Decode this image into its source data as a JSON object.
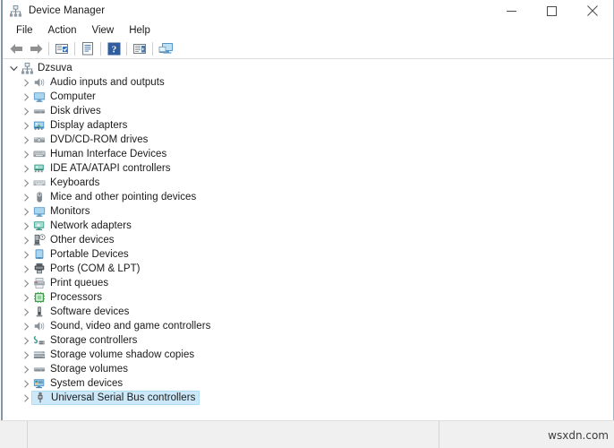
{
  "window": {
    "title": "Device Manager",
    "title_icon": "device-manager-icon",
    "controls": {
      "minimize": "minimize-icon",
      "maximize": "maximize-icon",
      "close": "close-icon"
    }
  },
  "menubar": {
    "items": [
      {
        "label": "File"
      },
      {
        "label": "Action"
      },
      {
        "label": "View"
      },
      {
        "label": "Help"
      }
    ]
  },
  "toolbar": {
    "buttons": [
      {
        "name": "back-button",
        "icon": "back-arrow-icon"
      },
      {
        "name": "forward-button",
        "icon": "forward-arrow-icon"
      },
      {
        "name": "separator-1",
        "icon": "separator"
      },
      {
        "name": "show-hidden-devices-button",
        "icon": "monitor-list-icon"
      },
      {
        "name": "separator-2",
        "icon": "separator"
      },
      {
        "name": "properties-button",
        "icon": "properties-page-icon"
      },
      {
        "name": "separator-3",
        "icon": "separator"
      },
      {
        "name": "help-button",
        "icon": "question-mark-icon"
      },
      {
        "name": "separator-4",
        "icon": "separator"
      },
      {
        "name": "scan-for-hardware-changes-button",
        "icon": "scan-hardware-icon"
      },
      {
        "name": "separator-5",
        "icon": "separator"
      },
      {
        "name": "update-driver-button",
        "icon": "computer-update-icon"
      }
    ]
  },
  "tree": {
    "root": {
      "label": "Dzsuva",
      "icon": "computer-root-icon",
      "expanded": true,
      "chevron": "chevron-down-icon"
    },
    "nodes": [
      {
        "label": "Audio inputs and outputs",
        "icon": "speaker-icon",
        "selected": false
      },
      {
        "label": "Computer",
        "icon": "monitor-icon",
        "selected": false
      },
      {
        "label": "Disk drives",
        "icon": "disk-drive-icon",
        "selected": false
      },
      {
        "label": "Display adapters",
        "icon": "display-adapter-icon",
        "selected": false
      },
      {
        "label": "DVD/CD-ROM drives",
        "icon": "optical-drive-icon",
        "selected": false
      },
      {
        "label": "Human Interface Devices",
        "icon": "hid-keyboard-icon",
        "selected": false
      },
      {
        "label": "IDE ATA/ATAPI controllers",
        "icon": "ide-controller-icon",
        "selected": false
      },
      {
        "label": "Keyboards",
        "icon": "keyboard-icon",
        "selected": false
      },
      {
        "label": "Mice and other pointing devices",
        "icon": "mouse-icon",
        "selected": false
      },
      {
        "label": "Monitors",
        "icon": "monitor-icon",
        "selected": false
      },
      {
        "label": "Network adapters",
        "icon": "network-adapter-icon",
        "selected": false
      },
      {
        "label": "Other devices",
        "icon": "unknown-device-icon",
        "selected": false
      },
      {
        "label": "Portable Devices",
        "icon": "portable-device-icon",
        "selected": false
      },
      {
        "label": "Ports (COM & LPT)",
        "icon": "port-icon",
        "selected": false
      },
      {
        "label": "Print queues",
        "icon": "printer-icon",
        "selected": false
      },
      {
        "label": "Processors",
        "icon": "processor-icon",
        "selected": false
      },
      {
        "label": "Software devices",
        "icon": "software-device-icon",
        "selected": false
      },
      {
        "label": "Sound, video and game controllers",
        "icon": "speaker-icon",
        "selected": false
      },
      {
        "label": "Storage controllers",
        "icon": "storage-controller-icon",
        "selected": false
      },
      {
        "label": "Storage volume shadow copies",
        "icon": "shadow-copy-icon",
        "selected": false
      },
      {
        "label": "Storage volumes",
        "icon": "storage-volume-icon",
        "selected": false
      },
      {
        "label": "System devices",
        "icon": "system-device-icon",
        "selected": false
      },
      {
        "label": "Universal Serial Bus controllers",
        "icon": "usb-icon",
        "selected": true
      }
    ],
    "child_chevron": "chevron-right-icon"
  },
  "statusbar": {
    "left_text": "",
    "right_text": ""
  },
  "watermark": {
    "text": "wsxdn.com"
  },
  "colors": {
    "selection_fill": "#cce8f9",
    "selection_border": "#addcf3",
    "window_border": "#9bb7c9",
    "statusbar_bg": "#f0f0f0",
    "text": "#1a1a1a"
  }
}
